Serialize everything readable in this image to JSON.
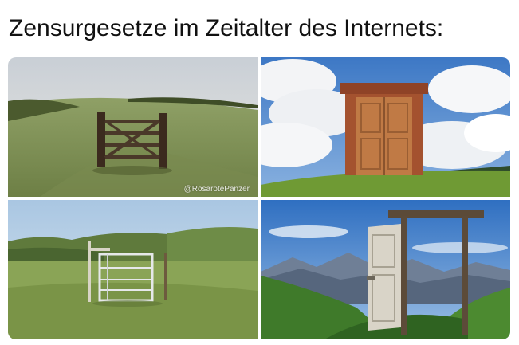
{
  "meme": {
    "caption": "Zensurgesetze im Zeitalter des Internets:",
    "watermark": "@RosarotePanzer"
  },
  "images": [
    {
      "name": "gate-in-field-photo"
    },
    {
      "name": "freestanding-door-photo"
    },
    {
      "name": "gate-on-grassland-photo"
    },
    {
      "name": "mountain-door-frame-photo"
    }
  ]
}
